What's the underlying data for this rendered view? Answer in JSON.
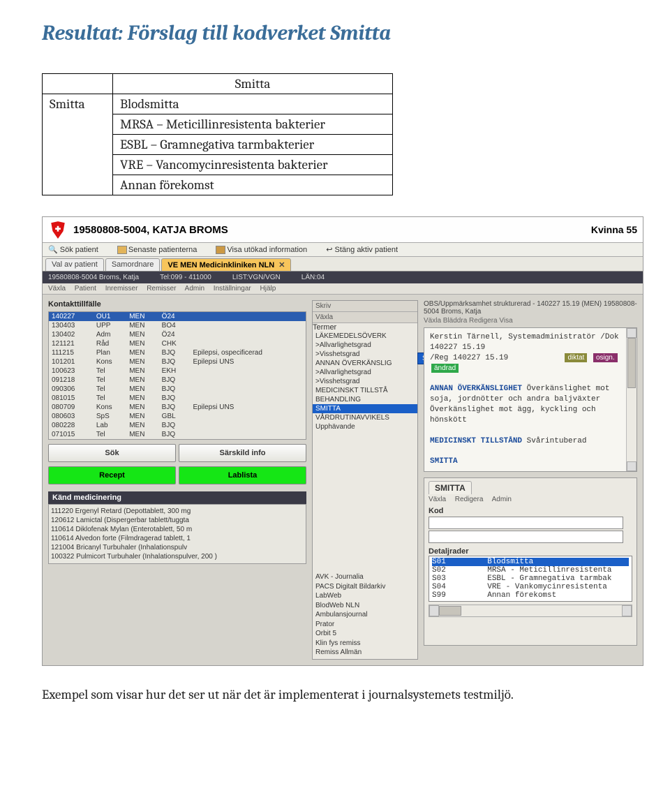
{
  "page_title": "Resultat: Förslag till kodverket Smitta",
  "code_table": {
    "header_main": "Smitta",
    "left_label": "Smitta",
    "rows": [
      "Blodsmitta",
      "MRSA – Meticillinresistenta bakterier",
      "ESBL – Gramnegativa tarmbakterier",
      "VRE – Vancomycinresistenta bakterier",
      "Annan förekomst"
    ]
  },
  "patient": {
    "id_name": "19580808-5004, KATJA BROMS",
    "info": "Kvinna 55"
  },
  "toolbar": {
    "sok": "Sök patient",
    "senaste": "Senaste patienterna",
    "visa": "Visa utökad information",
    "stang": "Stäng aktiv patient"
  },
  "tabs": {
    "t1": "Val av patient",
    "t2": "Samordnare",
    "t3": "VE MEN Medicinkliniken NLN"
  },
  "darkbar": {
    "a": "19580808-5004 Broms, Katja",
    "b": "Tel:099 - 411000",
    "c": "LIST:VGN/VGN",
    "d": "LÄN:04"
  },
  "menubar": {
    "m1": "Växla",
    "m2": "Patient",
    "m3": "Inremisser",
    "m4": "Remisser",
    "m5": "Admin",
    "m6": "Inställningar",
    "m7": "Hjälp"
  },
  "left": {
    "title": "Kontakttillfälle",
    "rows": [
      [
        "140227",
        "OU1",
        "MEN",
        "Ö24",
        ""
      ],
      [
        "130403",
        "UPP",
        "MEN",
        "BO4",
        ""
      ],
      [
        "130402",
        "Adm",
        "MEN",
        "Ö24",
        ""
      ],
      [
        "121121",
        "Råd",
        "MEN",
        "CHK",
        ""
      ],
      [
        "111215",
        "Plan",
        "MEN",
        "BJQ",
        "Epilepsi, ospecificerad"
      ],
      [
        "101201",
        "Kons",
        "MEN",
        "BJQ",
        "Epilepsi UNS"
      ],
      [
        "100623",
        "Tel",
        "MEN",
        "EKH",
        ""
      ],
      [
        "091218",
        "Tel",
        "MEN",
        "BJQ",
        ""
      ],
      [
        "090306",
        "Tel",
        "MEN",
        "BJQ",
        ""
      ],
      [
        "081015",
        "Tel",
        "MEN",
        "BJQ",
        ""
      ],
      [
        "080709",
        "Kons",
        "MEN",
        "BJQ",
        "Epilepsi UNS"
      ],
      [
        "080603",
        "SpS",
        "MEN",
        "GBL",
        ""
      ],
      [
        "080228",
        "Lab",
        "MEN",
        "BJQ",
        ""
      ],
      [
        "071015",
        "Tel",
        "MEN",
        "BJQ",
        ""
      ]
    ],
    "btn_sok": "Sök",
    "btn_info": "Särskild info",
    "btn_recept": "Recept",
    "btn_lablista": "Lablista",
    "kmed_title": "Känd medicinering",
    "kmed_lines": [
      "111220 Ergenyl Retard (Depottablett, 300 mg",
      "120612 Lamictal (Dispergerbar tablett/tuggta",
      "110614 Diklofenak Mylan (Enterotablett, 50 m",
      "110614 Alvedon forte (Filmdragerad tablett, 1",
      "121004 Bricanyl Turbuhaler (Inhalationspulv",
      "100322 Pulmicort Turbuhaler (Inhalationspulver, 200 )"
    ]
  },
  "mid": {
    "hdr1": "Skriv",
    "hdr2": "Växla",
    "termer_label": "Termer",
    "terms": [
      "LÄKEMEDELSÖVERK",
      ">Allvarlighetsgrad",
      ">Visshetsgrad",
      "ANNAN ÖVERKÄNSLIG",
      ">Allvarlighetsgrad",
      ">Visshetsgrad",
      "MEDICINSKT TILLSTÅ",
      "BEHANDLING",
      "SMITTA",
      "VÅRDRUTINAVVIKELS",
      "Upphävande"
    ],
    "sel_index": 8,
    "smitta_tag": "SMITTA",
    "bottom": [
      "AVK - Journalia",
      "PACS Digitalt Bildarkiv",
      "LabWeb",
      "BlodWeb NLN",
      "Ambulansjournal",
      "Prator",
      "Orbit 5",
      "Klin fys remiss",
      "Remiss Allmän"
    ]
  },
  "right": {
    "obs_title": "OBS/Uppmärksamhet strukturerad - 140227 15.19  (MEN)  19580808-5004  Broms, Katja",
    "obs_menu": "Växla   Bläddra   Redigera   Visa",
    "line1": "Kerstin Tärnell, Systemadministratör /Dok 140227 15.19",
    "line2": "/Reg 140227 15.19",
    "badge1": "diktat",
    "badge2": "osign.",
    "badge3": "ändrad",
    "sec1_title": "ANNAN ÖVERKÄNSLIGHET",
    "sec1_body": "Överkänslighet mot soja, jordnötter och andra baljväxter Överkänslighet mot ägg, kyckling och hönskött",
    "sec2_title": "MEDICINSKT TILLSTÅND",
    "sec2_body": "Svårintuberad",
    "sec3_title": "SMITTA",
    "panel_tab": "SMITTA",
    "panel_menu": {
      "m1": "Växla",
      "m2": "Redigera",
      "m3": "Admin"
    },
    "kod_label": "Kod",
    "detalj_label": "Detaljrader",
    "detalj_rows": [
      [
        "S01",
        "Blodsmitta"
      ],
      [
        "S02",
        "MRSA - Meticillinresistenta"
      ],
      [
        "S03",
        "ESBL - Gramnegativa tarmbak"
      ],
      [
        "S04",
        "VRE - Vankomycinresistenta"
      ],
      [
        "S99",
        "Annan förekomst"
      ]
    ]
  },
  "caption": "Exempel som visar hur det ser ut när det är implementerat i journalsystemets testmiljö."
}
